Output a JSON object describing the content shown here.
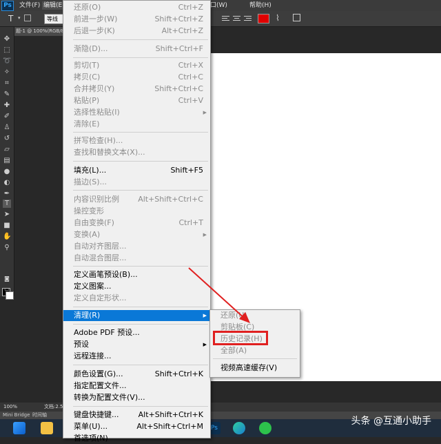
{
  "menubar": {
    "logo": "Ps",
    "items": [
      "文件(F)",
      "编辑(E)",
      "",
      "",
      "",
      "",
      "",
      "",
      "",
      "口(W)",
      "帮助(H)"
    ]
  },
  "optbar": {
    "font_size": "T",
    "font_weight": "等线",
    "accent_color": "#e00000"
  },
  "doc_tab": "题-1 @ 100%(RGB/8)",
  "edit_menu": {
    "items": [
      {
        "label": "还原(O)",
        "shortcut": "Ctrl+Z",
        "disabled": true
      },
      {
        "label": "前进一步(W)",
        "shortcut": "Shift+Ctrl+Z",
        "disabled": true
      },
      {
        "label": "后退一步(K)",
        "shortcut": "Alt+Ctrl+Z",
        "disabled": true
      },
      {
        "label": "渐隐(D)...",
        "shortcut": "Shift+Ctrl+F",
        "disabled": true
      },
      {
        "label": "剪切(T)",
        "shortcut": "Ctrl+X",
        "disabled": true
      },
      {
        "label": "拷贝(C)",
        "shortcut": "Ctrl+C",
        "disabled": true
      },
      {
        "label": "合并拷贝(Y)",
        "shortcut": "Shift+Ctrl+C",
        "disabled": true
      },
      {
        "label": "粘贴(P)",
        "shortcut": "Ctrl+V",
        "disabled": true
      },
      {
        "label": "选择性粘贴(I)",
        "shortcut": "",
        "disabled": true
      },
      {
        "label": "清除(E)",
        "shortcut": "",
        "disabled": true
      },
      {
        "label": "拼写检查(H)...",
        "shortcut": "",
        "disabled": true
      },
      {
        "label": "查找和替换文本(X)...",
        "shortcut": "",
        "disabled": true
      },
      {
        "label": "填充(L)...",
        "shortcut": "Shift+F5",
        "disabled": false
      },
      {
        "label": "描边(S)...",
        "shortcut": "",
        "disabled": true
      },
      {
        "label": "内容识别比例",
        "shortcut": "Alt+Shift+Ctrl+C",
        "disabled": true
      },
      {
        "label": "操控变形",
        "shortcut": "",
        "disabled": true
      },
      {
        "label": "自由变换(F)",
        "shortcut": "Ctrl+T",
        "disabled": true
      },
      {
        "label": "变换(A)",
        "shortcut": "",
        "disabled": true
      },
      {
        "label": "自动对齐图层...",
        "shortcut": "",
        "disabled": true
      },
      {
        "label": "自动混合图层...",
        "shortcut": "",
        "disabled": true
      },
      {
        "label": "定义画笔预设(B)...",
        "shortcut": "",
        "disabled": false
      },
      {
        "label": "定义图案...",
        "shortcut": "",
        "disabled": false
      },
      {
        "label": "定义自定形状...",
        "shortcut": "",
        "disabled": true
      },
      {
        "label": "清理(R)",
        "shortcut": "",
        "disabled": false
      },
      {
        "label": "Adobe PDF 预设...",
        "shortcut": "",
        "disabled": false
      },
      {
        "label": "预设",
        "shortcut": "",
        "disabled": false
      },
      {
        "label": "远程连接...",
        "shortcut": "",
        "disabled": false
      },
      {
        "label": "颜色设置(G)...",
        "shortcut": "Shift+Ctrl+K",
        "disabled": false
      },
      {
        "label": "指定配置文件...",
        "shortcut": "",
        "disabled": false
      },
      {
        "label": "转换为配置文件(V)...",
        "shortcut": "",
        "disabled": false
      },
      {
        "label": "键盘快捷键...",
        "shortcut": "Alt+Shift+Ctrl+K",
        "disabled": false
      },
      {
        "label": "菜单(U)...",
        "shortcut": "Alt+Shift+Ctrl+M",
        "disabled": false
      },
      {
        "label": "首选项(N)",
        "shortcut": "",
        "disabled": false
      }
    ]
  },
  "purge_submenu": {
    "items": [
      {
        "label": "还原(U)",
        "disabled": true
      },
      {
        "label": "剪贴板(C)",
        "disabled": true
      },
      {
        "label": "历史记录(H)",
        "disabled": true
      },
      {
        "label": "全部(A)",
        "disabled": true
      },
      {
        "label": "视频高速缓存(V)",
        "disabled": false
      }
    ]
  },
  "status": {
    "zoom": "100%",
    "doc": "文档:2.5",
    "tab_bridge": "Mini Bridge",
    "tab_timeline": "时间轴"
  },
  "watermark": "头条 @互通小助手",
  "colors": {
    "highlight": "#0a78d7",
    "annotation_red": "#e02020"
  }
}
